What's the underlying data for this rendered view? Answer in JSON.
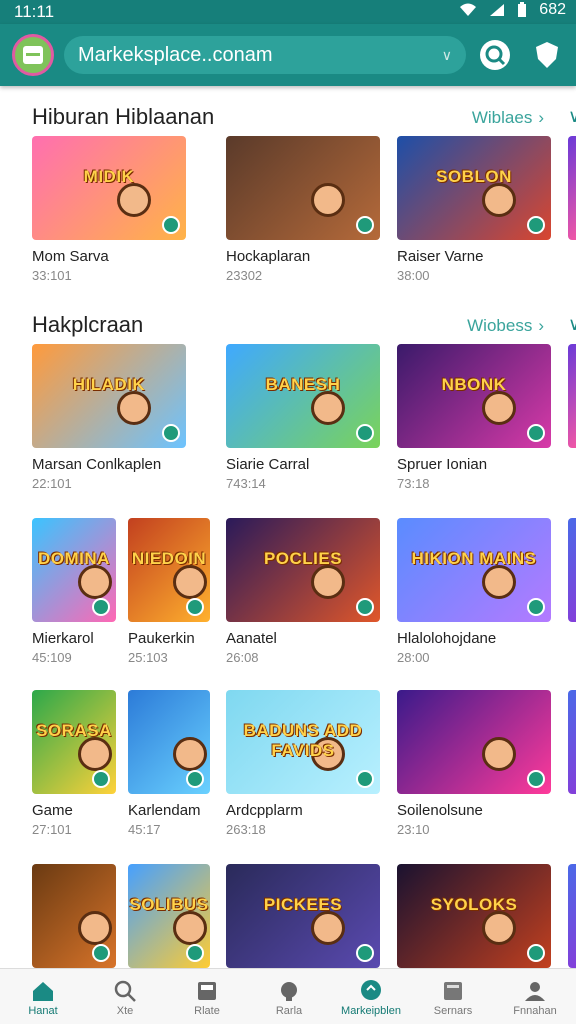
{
  "statusbar": {
    "time": "11:11",
    "battery": "682"
  },
  "header": {
    "url": "Markeksplace..conam"
  },
  "sections": [
    {
      "title": "Hiburan Hiblaanan",
      "see_all": "Wiblaes",
      "cards": [
        {
          "name": "Mom Sarva",
          "meta": "33:101",
          "cap": "MIDIK",
          "colors": [
            "#ff6fb0",
            "#ffb347"
          ]
        },
        {
          "name": "Hockaplaran",
          "meta": "23302",
          "cap": "",
          "colors": [
            "#5a3a2a",
            "#b56a3a"
          ]
        },
        {
          "name": "Raiser Varne",
          "meta": "38:00",
          "cap": "SOBLON",
          "colors": [
            "#1d4fa8",
            "#d9462f"
          ]
        }
      ]
    },
    {
      "title": "Hakplcraan",
      "see_all": "Wiobess",
      "cards": [
        {
          "name": "Marsan Conlkaplen",
          "meta": "22:101",
          "cap": "HILADIK",
          "colors": [
            "#ff9a3c",
            "#6cc3ff"
          ]
        },
        {
          "name": "Siarie Carral",
          "meta": "743:14",
          "cap": "BANESH",
          "colors": [
            "#3fa9ff",
            "#7ad35a"
          ]
        },
        {
          "name": "Spruer Ionian",
          "meta": "73:18",
          "cap": "NBONK",
          "colors": [
            "#3a1a6a",
            "#d83aa8"
          ]
        }
      ]
    }
  ],
  "grid_rows": [
    [
      {
        "name": "Mierkarol",
        "meta": "45:109",
        "cap": "DOMINA",
        "colors": [
          "#3ac4ff",
          "#ff68b4"
        ]
      },
      {
        "name": "Paukerkin",
        "meta": "25:103",
        "cap": "NIEDOIN",
        "colors": [
          "#c2401f",
          "#ffb12e"
        ]
      },
      {
        "name": "Aanatel",
        "meta": "26:08",
        "cap": "POCLIES",
        "colors": [
          "#2a1a5a",
          "#e0572a"
        ]
      },
      {
        "name": "Hlalolohojdane",
        "meta": "28:00",
        "cap": "HIKION MAINS",
        "colors": [
          "#5a8cff",
          "#b47aff"
        ]
      }
    ],
    [
      {
        "name": "Game",
        "meta": "27:101",
        "cap": "SORASA",
        "colors": [
          "#2ca84a",
          "#ffd23a"
        ]
      },
      {
        "name": "Karlendam",
        "meta": "45:17",
        "cap": "",
        "colors": [
          "#2c7bd8",
          "#6ad1ff"
        ]
      },
      {
        "name": "Ardcpplarm",
        "meta": "263:18",
        "cap": "BADUNS ADD FAVIDS",
        "colors": [
          "#7fd8f0",
          "#b8f0ff"
        ]
      },
      {
        "name": "Soilenolsune",
        "meta": "23:10",
        "cap": "",
        "colors": [
          "#3a1a8a",
          "#ff3a9a"
        ]
      }
    ],
    [
      {
        "name": "",
        "meta": "",
        "cap": "",
        "colors": [
          "#6a3a12",
          "#d8742a"
        ]
      },
      {
        "name": "",
        "meta": "",
        "cap": "SOLIBUS",
        "colors": [
          "#46a0ff",
          "#ffcc33"
        ]
      },
      {
        "name": "",
        "meta": "",
        "cap": "PICKEES",
        "colors": [
          "#2a2a5a",
          "#5a4ab0"
        ]
      },
      {
        "name": "",
        "meta": "",
        "cap": "SYOLOKS",
        "colors": [
          "#1a1230",
          "#c2401f"
        ]
      }
    ]
  ],
  "bottomnav": [
    {
      "label": "Hanat",
      "icon": "home-icon"
    },
    {
      "label": "Xte",
      "icon": "search-icon"
    },
    {
      "label": "Rlate",
      "icon": "apps-icon"
    },
    {
      "label": "Rarla",
      "icon": "book-icon"
    },
    {
      "label": "Markeipblen",
      "icon": "marketplace-icon"
    },
    {
      "label": "Sernars",
      "icon": "news-icon"
    },
    {
      "label": "Fnnahan",
      "icon": "profile-icon"
    }
  ],
  "colors": {
    "brand": "#1a8a84",
    "accent": "#3aa49c"
  }
}
